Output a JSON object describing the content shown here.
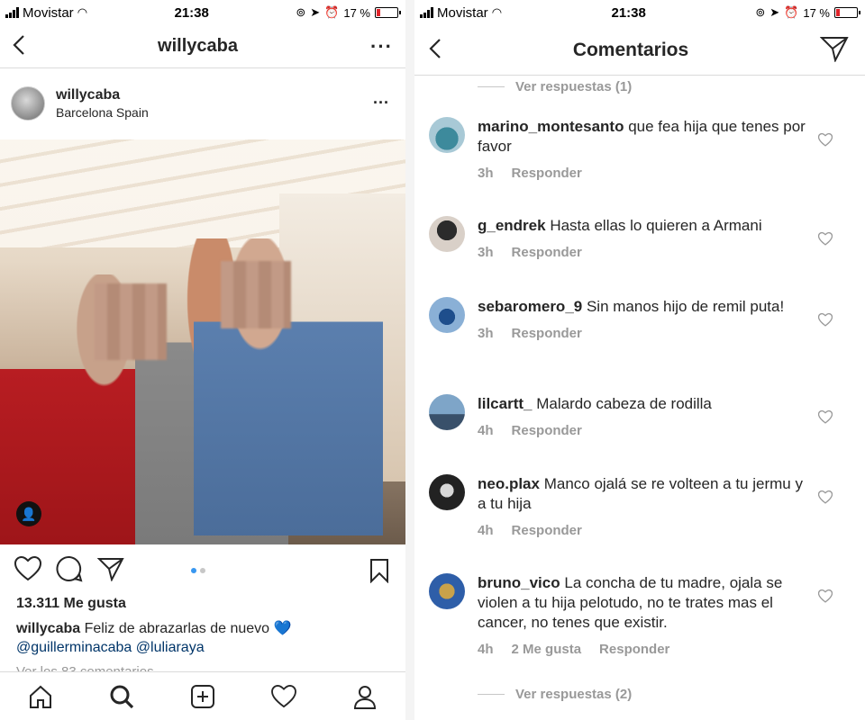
{
  "status_bar": {
    "carrier": "Movistar",
    "time": "21:38",
    "battery": "17 %",
    "battery_level": 0.17
  },
  "post_screen": {
    "nav_title": "willycaba",
    "post": {
      "username": "willycaba",
      "location": "Barcelona Spain",
      "likes": "13.311 Me gusta",
      "caption_user": "willycaba",
      "caption_text": "Feliz de abrazarlas de nuevo",
      "caption_emoji": "💙",
      "mentions": [
        "@guillerminacaba",
        "@luliaraya"
      ],
      "view_comments": "Ver los 83 comentarios"
    },
    "tabs": [
      "home-icon",
      "search-icon",
      "add-icon",
      "heart-icon",
      "profile-icon"
    ]
  },
  "comments_screen": {
    "nav_title": "Comentarios",
    "view_replies_top": "Ver respuestas (1)",
    "view_replies_bottom": "Ver respuestas (2)",
    "reply_label": "Responder",
    "comments": [
      {
        "username": "marino_montesanto",
        "text": "que fea hija que tenes por favor",
        "time": "3h",
        "likes": ""
      },
      {
        "username": "g_endrek",
        "text": "Hasta ellas lo quieren a Armani",
        "time": "3h",
        "likes": ""
      },
      {
        "username": "sebaromero_9",
        "text": "Sin manos hijo de remil puta!",
        "time": "3h",
        "likes": ""
      },
      {
        "username": "lilcartt_",
        "text": "Malardo cabeza de rodilla",
        "time": "4h",
        "likes": ""
      },
      {
        "username": "neo.plax",
        "text": "Manco ojalá se re volteen a tu jermu y a tu hija",
        "time": "4h",
        "likes": ""
      },
      {
        "username": "bruno_vico",
        "text": "La concha de tu madre, ojala se violen a tu hija pelotudo, no te trates mas el cancer, no tenes que existir.",
        "time": "4h",
        "likes": "2 Me gusta"
      }
    ]
  },
  "colors": {
    "link": "#003569",
    "muted": "#999999",
    "carousel_active": "#3897f0",
    "battery_low": "#e0242a"
  }
}
